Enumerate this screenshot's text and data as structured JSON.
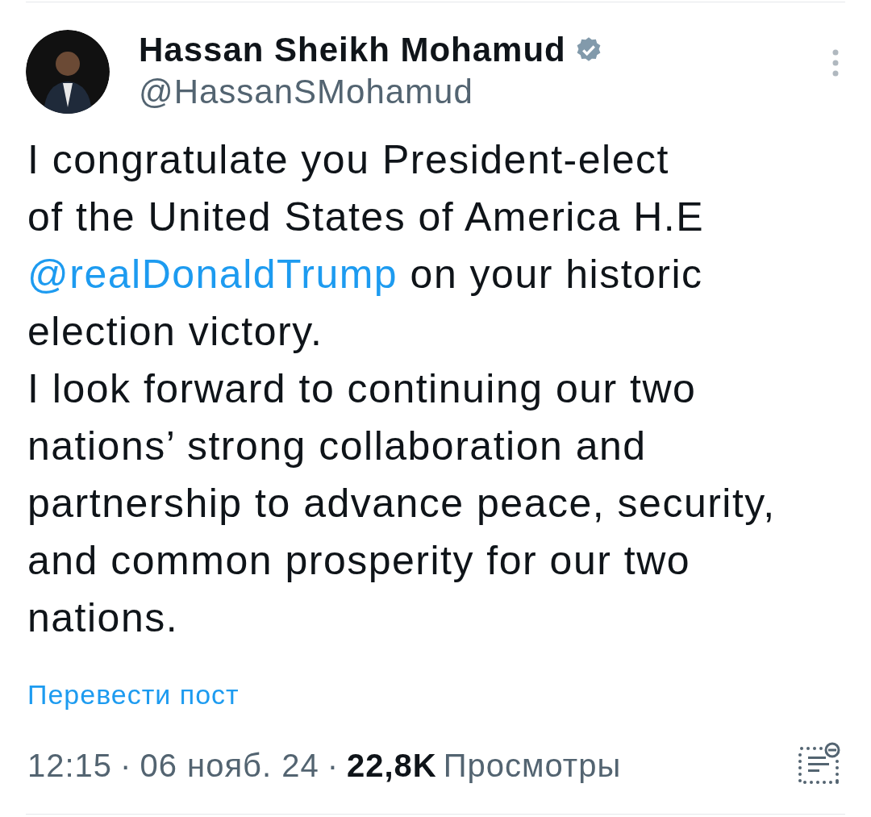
{
  "author": {
    "name": "Hassan Sheikh Mohamud",
    "verified": true,
    "handle": "@HassanSMohamud"
  },
  "body": [
    {
      "parts": [
        {
          "kind": "text",
          "text": "I congratulate you President-elect\nof the United States of America H.E\n"
        },
        {
          "kind": "mention",
          "text": "@realDonaldTrump"
        },
        {
          "kind": "text",
          "text": " on your historic\nelection victory."
        }
      ]
    },
    {
      "parts": [
        {
          "kind": "text",
          "text": "I look forward to continuing our two\nnations’ strong collaboration and\npartnership to advance peace, security,\nand common prosperity for our two\nnations."
        }
      ]
    }
  ],
  "translate_link": "Перевести пост",
  "meta": {
    "time": "12:15",
    "separator": "·",
    "date": "06 нояб. 24",
    "views_count": "22,8K",
    "views_label": "Просмотры"
  }
}
